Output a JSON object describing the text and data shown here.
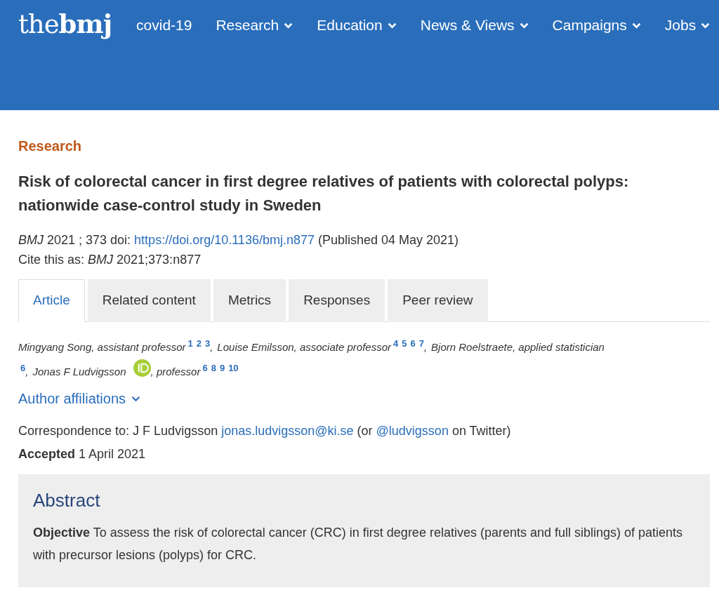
{
  "header": {
    "logo": "the**bmj**",
    "nav": [
      {
        "label": "covid-19",
        "dropdown": false
      },
      {
        "label": "Research",
        "dropdown": true
      },
      {
        "label": "Education",
        "dropdown": true
      },
      {
        "label": "News & Views",
        "dropdown": true
      },
      {
        "label": "Campaigns",
        "dropdown": true
      },
      {
        "label": "Jobs",
        "dropdown": true
      }
    ]
  },
  "article": {
    "section": "Research",
    "title": "Risk of colorectal cancer in first degree relatives of patients with colorectal polyps: nationwide case-control study in Sweden",
    "citation_before": "*BMJ*  2021 ; 373  doi: ",
    "doi": "https://doi.org/10.1136/bmj.n877",
    "citation_after": " (Published 04 May 2021)",
    "cite_as": "Cite this as: *BMJ*  2021;373:n877",
    "tabs": [
      {
        "label": "Article",
        "selected": true
      },
      {
        "label": "Related content",
        "selected": false
      },
      {
        "label": "Metrics",
        "selected": false
      },
      {
        "label": "Responses",
        "selected": false
      },
      {
        "label": "Peer review",
        "selected": false
      }
    ],
    "authors": [
      {
        "name": "Mingyang Song",
        "orcid": false,
        "role": ", assistant professor",
        "refs": [
          "1",
          "2",
          "3"
        ],
        "separator": ","
      },
      {
        "name": "Louise Emilsson",
        "orcid": false,
        "role": ", associate professor",
        "refs": [
          "4",
          "5",
          "6",
          "7"
        ],
        "separator": ","
      },
      {
        "name": "Bjorn Roelstraete",
        "orcid": false,
        "role": ", applied statistician",
        "refs": [
          "6"
        ],
        "separator": ","
      },
      {
        "name": "Jonas F Ludvigsson",
        "orcid": true,
        "role": ", professor",
        "refs": [
          "6",
          "8",
          "9",
          "10"
        ]
      }
    ],
    "affiliations": {
      "label": "Author affiliations",
      "expanded": false
    },
    "correspondence": {
      "before": "Correspondence to: J F Ludvigsson ",
      "email": "jonas.ludvigsson@ki.se",
      "middle": " (or ",
      "twitter": "@ludvigsson",
      "after": " on Twitter)"
    },
    "accepted": "**Accepted** 1 April 2021",
    "abstract": {
      "heading": "Abstract",
      "text": "**Objective** To assess the risk of colorectal cancer (CRC) in first degree relatives (parents and full siblings) of patients with precursor lesions (polyps) for CRC."
    }
  }
}
